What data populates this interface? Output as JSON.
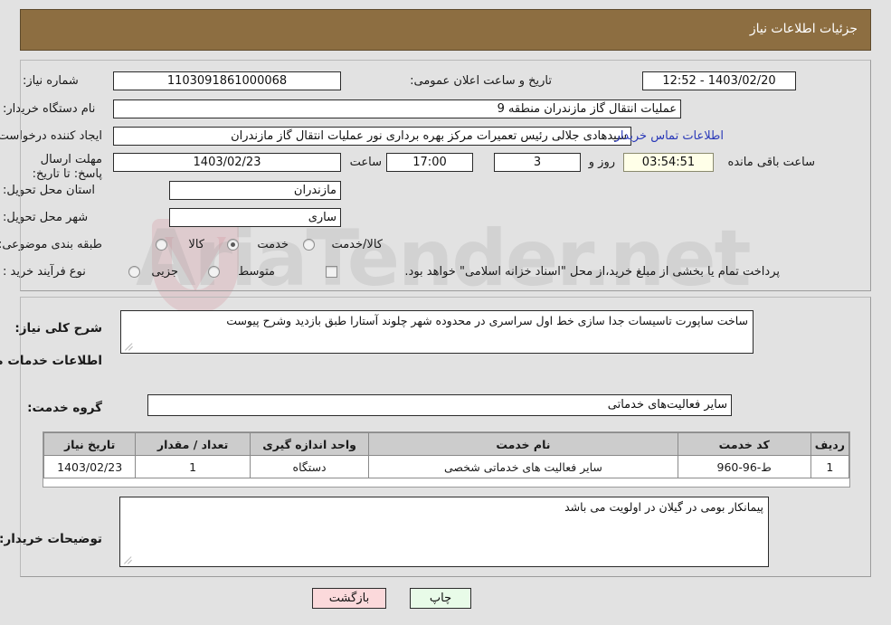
{
  "header": {
    "title": "جزئیات اطلاعات نیاز"
  },
  "watermark": {
    "text": "AriaTender.net"
  },
  "fields": {
    "need_number_label": "شماره نیاز:",
    "need_number_value": "1103091861000068",
    "announce_label": "تاریخ و ساعت اعلان عمومی:",
    "announce_value": "1403/02/20 - 12:52",
    "buyer_org_label": "نام دستگاه خریدار:",
    "buyer_org_value": "عملیات انتقال گاز مازندران منطقه 9",
    "requester_label": "ایجاد کننده درخواست:",
    "requester_value": "سیدهادی جلالی رئیس تعمیرات مرکز بهره برداری نور عملیات انتقال گاز مازندران",
    "buyer_contact_link": "اطلاعات تماس خریدار",
    "deadline_label": "مهلت ارسال پاسخ: تا تاریخ:",
    "deadline_date": "1403/02/23",
    "time_label": "ساعت",
    "time_value": "17:00",
    "days_value": "3",
    "days_label": "روز و",
    "countdown_value": "03:54:51",
    "countdown_label": "ساعت باقی مانده",
    "province_label": "استان محل تحویل:",
    "province_value": "مازندران",
    "city_label": "شهر محل تحویل:",
    "city_value": "ساری",
    "category_label": "طبقه بندی موضوعی:",
    "category_opt_goods": "کالا",
    "category_opt_service": "خدمت",
    "category_opt_both": "کالا/خدمت",
    "category_selected": "خدمت",
    "process_label": "نوع فرآیند خرید :",
    "process_opt_minor": "جزیی",
    "process_opt_medium": "متوسط",
    "process_selected": "",
    "treasury_checkbox_label": "پرداخت تمام یا بخشی از مبلغ خرید،از محل \"اسناد خزانه اسلامی\" خواهد بود.",
    "treasury_checked": false
  },
  "description": {
    "label": "شرح کلی نیاز:",
    "value": "ساخت ساپورت تاسیسات جدا سازی خط اول سراسری در محدوده شهر چلوند آستارا طبق بازدید وشرح پیوست"
  },
  "services_section": {
    "heading": "اطلاعات خدمات مورد نیاز",
    "group_label": "گروه خدمت:",
    "group_value": "سایر فعالیت‌های خدماتی"
  },
  "table": {
    "headers": [
      "ردیف",
      "کد خدمت",
      "نام خدمت",
      "واحد اندازه گیری",
      "تعداد / مقدار",
      "تاریخ نیاز"
    ],
    "rows": [
      {
        "index": "1",
        "code": "ط-96-960",
        "name": "سایر فعالیت های خدماتی شخصی",
        "unit": "دستگاه",
        "qty": "1",
        "need_date": "1403/02/23"
      }
    ]
  },
  "buyer_notes": {
    "label": "توضیحات خریدار:",
    "value": "پیمانکار بومی در گیلان در اولویت می باشد"
  },
  "footer": {
    "print_label": "چاپ",
    "back_label": "بازگشت"
  },
  "colors": {
    "header_bg": "#8D6E41",
    "page_bg": "#E2E2E2",
    "link": "#2A39B8",
    "table_header_bg": "#CCCCCC",
    "countdown_bg": "#FFFFE8",
    "print_btn_bg": "#E8FBE8",
    "back_btn_bg": "#FBD9DB"
  }
}
